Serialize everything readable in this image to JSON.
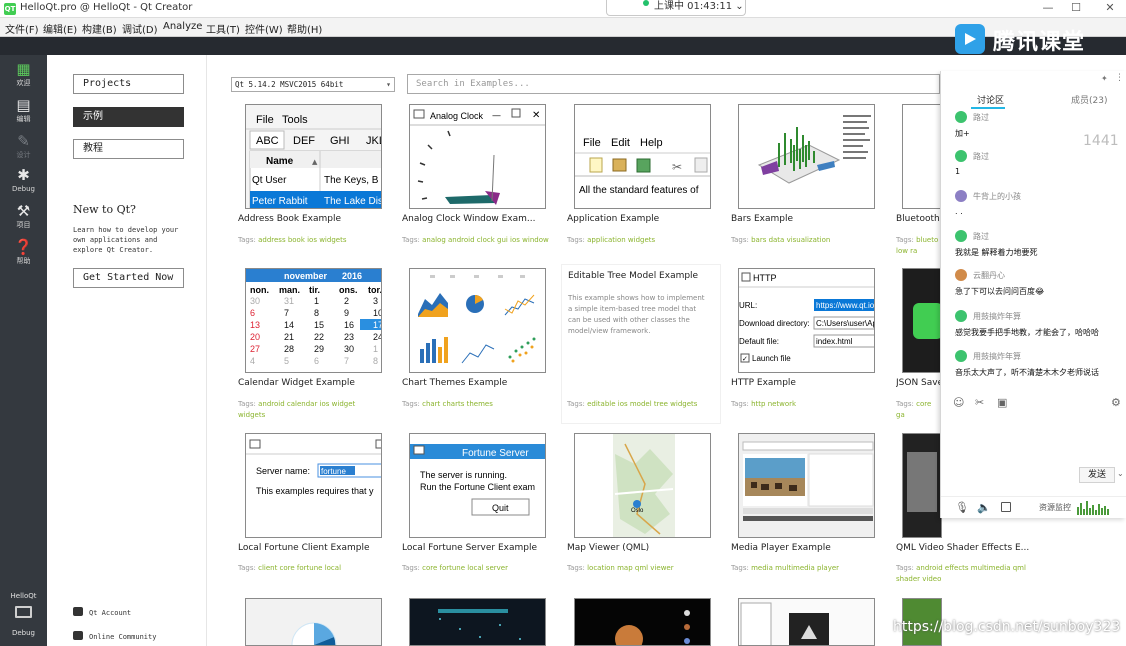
{
  "window": {
    "title": "HelloQt.pro @ HelloQt - Qt Creator",
    "app_icon": "QT",
    "live_status": "上课中 01:43:11",
    "controls": [
      "—",
      "☐",
      "✕"
    ]
  },
  "menu": [
    "文件(F)",
    "编辑(E)",
    "构建(B)",
    "调试(D)",
    "Analyze",
    "工具(T)",
    "控件(W)",
    "帮助(H)"
  ],
  "modes": [
    {
      "label": "欢迎",
      "icon": "grid-icon"
    },
    {
      "label": "编辑",
      "icon": "document-icon"
    },
    {
      "label": "设计",
      "icon": "pencil-icon"
    },
    {
      "label": "Debug",
      "icon": "bug-icon"
    },
    {
      "label": "项目",
      "icon": "wrench-icon"
    },
    {
      "label": "帮助",
      "icon": "help-icon"
    }
  ],
  "kit": {
    "project": "HelloQt",
    "label": "Debug"
  },
  "welcome": {
    "projects": "Projects",
    "examples": "示例",
    "tutorials": "教程",
    "new_to_title": "New to Qt?",
    "new_to_desc": "Learn how to develop your own applications and explore Qt Creator.",
    "get_started": "Get Started Now",
    "qt_account": "Qt Account",
    "online_community": "Online Community"
  },
  "toolbar": {
    "kit_select": "Qt 5.14.2 MSVC2015 64bit",
    "search_placeholder": "Search in Examples..."
  },
  "examples": [
    {
      "title": "Address Book Example",
      "tags": "address book ios widgets"
    },
    {
      "title": "Analog Clock Window Exam...",
      "tags": "analog android clock gui ios window"
    },
    {
      "title": "Application Example",
      "tags": "application widgets"
    },
    {
      "title": "Bars Example",
      "tags": "bars data visualization"
    },
    {
      "title": "Bluetooth",
      "tags": "blueto low ra"
    },
    {
      "title": "Calendar Widget Example",
      "tags": "android calendar ios widget widgets"
    },
    {
      "title": "Chart Themes Example",
      "tags": "chart charts themes"
    },
    {
      "title": "",
      "tags": "editable ios model tree widgets"
    },
    {
      "title": "HTTP Example",
      "tags": "http network"
    },
    {
      "title": "JSON Save",
      "tags": "core ga"
    },
    {
      "title": "Local Fortune Client Example",
      "tags": "client core fortune local"
    },
    {
      "title": "Local Fortune Server Example",
      "tags": "core fortune local server"
    },
    {
      "title": "Map Viewer (QML)",
      "tags": "location map qml viewer"
    },
    {
      "title": "Media Player Example",
      "tags": "media multimedia player"
    },
    {
      "title": "QML Video Shader Effects E...",
      "tags": "android effects multimedia qml shader video"
    }
  ],
  "tags_label": "Tags:",
  "thumbs": {
    "addr_menu": [
      "File",
      "Tools"
    ],
    "addr_tabs": [
      "ABC",
      "DEF",
      "GHI",
      "JKL"
    ],
    "addr_header": "Name",
    "addr_rows": [
      [
        "Qt User",
        "The Keys, B"
      ],
      [
        "Peter Rabbit",
        "The Lake Dis"
      ]
    ],
    "clock_title": "Analog Clock",
    "app_menu": [
      "File",
      "Edit",
      "Help"
    ],
    "app_text": "All the standard features of",
    "cal_month": "november",
    "cal_year": "2016",
    "cal_days": [
      "non.",
      "man.",
      "tir.",
      "ons.",
      "tor."
    ],
    "cal_rows": [
      [
        "30",
        "31",
        "1",
        "2",
        "3"
      ],
      [
        "6",
        "7",
        "8",
        "9",
        "10"
      ],
      [
        "13",
        "14",
        "15",
        "16",
        "17"
      ],
      [
        "20",
        "21",
        "22",
        "23",
        "24"
      ],
      [
        "27",
        "28",
        "29",
        "30",
        "1"
      ],
      [
        "4",
        "5",
        "6",
        "7",
        "8"
      ]
    ],
    "tree_title": "Editable Tree Model Example",
    "tree_desc": "This example shows how to implement a simple item-based tree model that can be used with other classes the model/view framework.",
    "http_title": "HTTP",
    "http_url_label": "URL:",
    "http_url": "https://www.qt.io",
    "http_dir_label": "Download directory:",
    "http_dir": "C:\\Users\\user\\Ap",
    "http_file_label": "Default file:",
    "http_file": "index.html",
    "http_launch": "Launch file",
    "client_server_label": "Server name:",
    "client_server_value": "fortune",
    "client_text": "This examples requires that y",
    "server_title": "Fortune Server",
    "server_text1": "The server is running.",
    "server_text2": "Run the Fortune Client exam",
    "server_quit": "Quit",
    "map_label": "Oslo"
  },
  "chat": {
    "tabs": [
      "讨论区",
      "成员(23)"
    ],
    "messages": [
      {
        "name": "路过",
        "text": "加+"
      },
      {
        "name": "路过",
        "text": "1"
      },
      {
        "name": "牛背上的小孩",
        "text": ". ."
      },
      {
        "name": "路过",
        "text": "我就是  解释着力地要死"
      },
      {
        "name": "云翻丹心",
        "text": "急了下可以去问问百度😂"
      },
      {
        "name": "用鼓搞炸年算",
        "text": "感觉我要手把手地教，才能会了，哈哈哈"
      },
      {
        "name": "用鼓搞炸年算",
        "text": "音乐太大声了，听不清楚木木夕老师说话"
      }
    ],
    "send": "发送",
    "resource_monitor": "资源监控"
  },
  "overlays": {
    "logo": "腾讯课堂",
    "watermark": "https://blog.csdn.net/sunboy323",
    "ghost_number": "1441"
  }
}
